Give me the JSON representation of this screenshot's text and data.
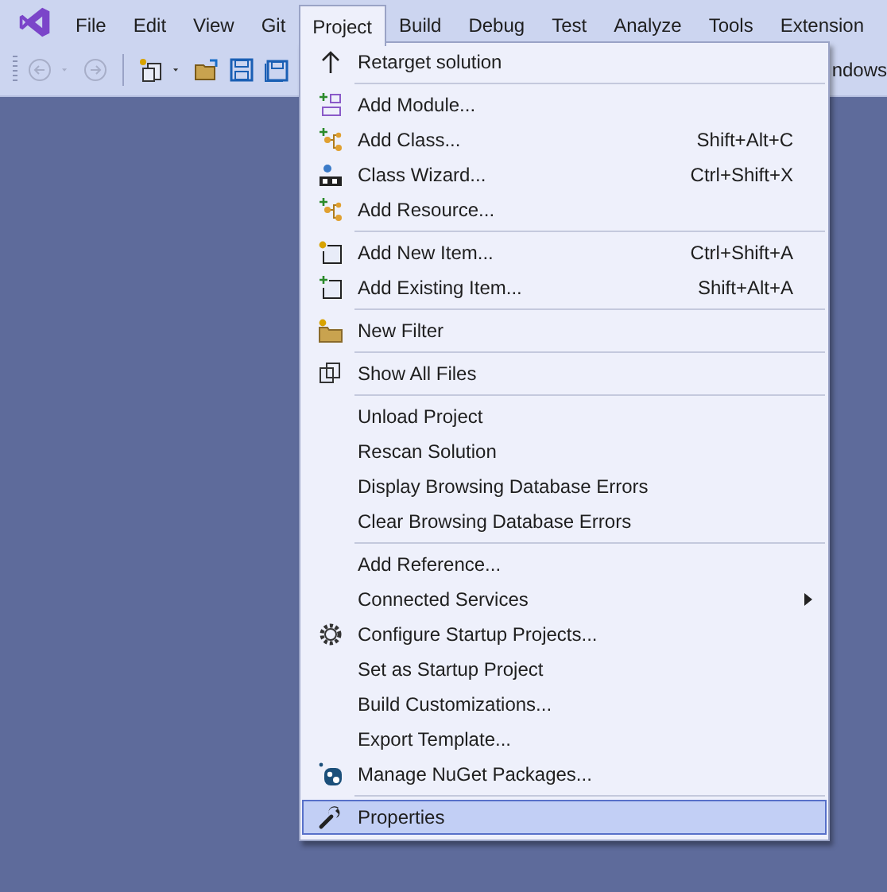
{
  "menu_bar": {
    "items": [
      {
        "label": "File",
        "selected": false
      },
      {
        "label": "Edit",
        "selected": false
      },
      {
        "label": "View",
        "selected": false
      },
      {
        "label": "Git",
        "selected": false
      },
      {
        "label": "Project",
        "selected": true
      },
      {
        "label": "Build",
        "selected": false
      },
      {
        "label": "Debug",
        "selected": false
      },
      {
        "label": "Test",
        "selected": false
      },
      {
        "label": "Analyze",
        "selected": false
      },
      {
        "label": "Tools",
        "selected": false
      },
      {
        "label": "Extension",
        "selected": false
      }
    ]
  },
  "toolbar": {
    "partial_text": "ndows"
  },
  "project_menu": {
    "groups": [
      [
        {
          "label": "Retarget solution",
          "selected": false
        }
      ],
      [
        {
          "label": "Add Module...",
          "selected": false
        },
        {
          "label": "Add Class...",
          "shortcut": "Shift+Alt+C",
          "selected": false
        },
        {
          "label": "Class Wizard...",
          "shortcut": "Ctrl+Shift+X",
          "selected": false
        },
        {
          "label": "Add Resource...",
          "selected": false
        }
      ],
      [
        {
          "label": "Add New Item...",
          "shortcut": "Ctrl+Shift+A",
          "selected": false
        },
        {
          "label": "Add Existing Item...",
          "shortcut": "Shift+Alt+A",
          "selected": false
        }
      ],
      [
        {
          "label": "New Filter",
          "selected": false
        }
      ],
      [
        {
          "label": "Show All Files",
          "selected": false
        }
      ],
      [
        {
          "label": "Unload Project",
          "selected": false
        },
        {
          "label": "Rescan Solution",
          "selected": false
        },
        {
          "label": "Display Browsing Database Errors",
          "selected": false
        },
        {
          "label": "Clear Browsing Database Errors",
          "selected": false
        }
      ],
      [
        {
          "label": "Add Reference...",
          "selected": false
        },
        {
          "label": "Connected Services",
          "submenu": true,
          "selected": false
        },
        {
          "label": "Configure Startup Projects...",
          "selected": false
        },
        {
          "label": "Set as Startup Project",
          "selected": false
        },
        {
          "label": "Build Customizations...",
          "selected": false
        },
        {
          "label": "Export Template...",
          "selected": false
        },
        {
          "label": "Manage NuGet Packages...",
          "selected": false
        }
      ],
      [
        {
          "label": "Properties",
          "selected": true
        }
      ]
    ]
  }
}
